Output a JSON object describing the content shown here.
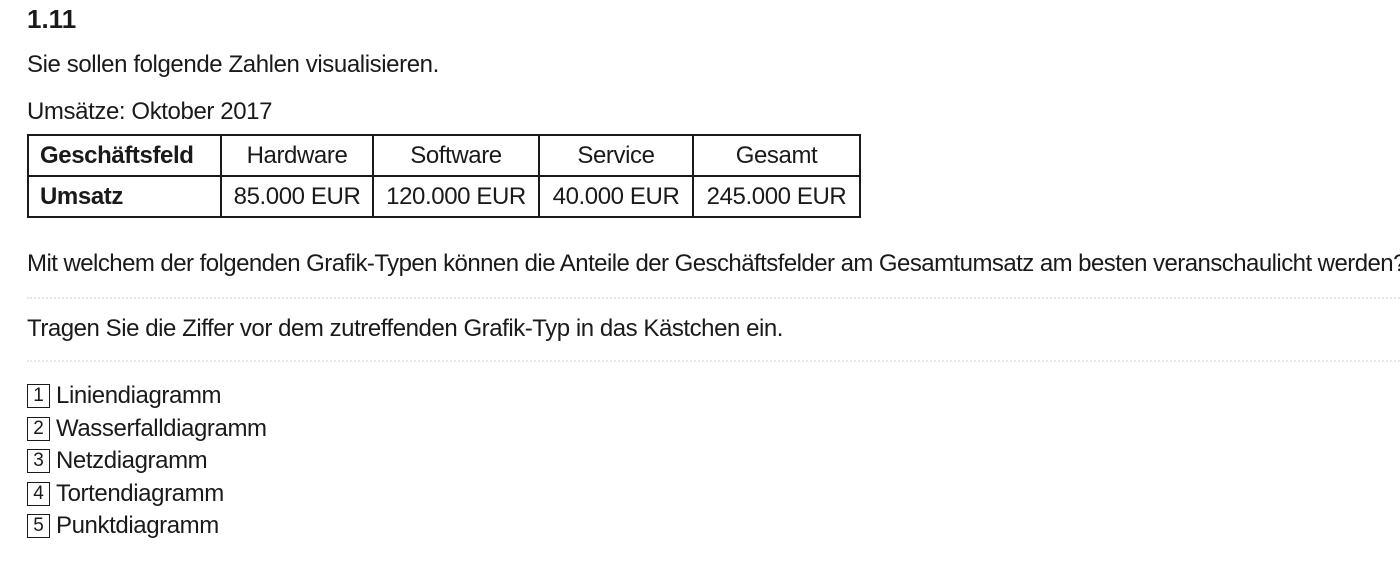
{
  "task": {
    "number": "1.11",
    "intro": "Sie sollen folgende Zahlen visualisieren.",
    "table_caption": "Umsätze: Oktober 2017"
  },
  "table": {
    "header": [
      "Geschäftsfeld",
      "Hardware",
      "Software",
      "Service",
      "Gesamt"
    ],
    "row": [
      "Umsatz",
      "85.000 EUR",
      "120.000 EUR",
      "40.000 EUR",
      "245.000 EUR"
    ]
  },
  "question": "Mit welchem der folgenden Grafik-Typen können die Anteile der Geschäftsfelder am Gesamtumsatz am besten veranschaulicht werden?",
  "instruction": "Tragen Sie die Ziffer vor dem zutreffenden Grafik-Typ in das Kästchen ein.",
  "options": [
    {
      "number": "1",
      "label": "Liniendiagramm"
    },
    {
      "number": "2",
      "label": "Wasserfalldiagramm"
    },
    {
      "number": "3",
      "label": "Netzdiagramm"
    },
    {
      "number": "4",
      "label": "Tortendiagramm"
    },
    {
      "number": "5",
      "label": "Punktdiagramm"
    }
  ]
}
